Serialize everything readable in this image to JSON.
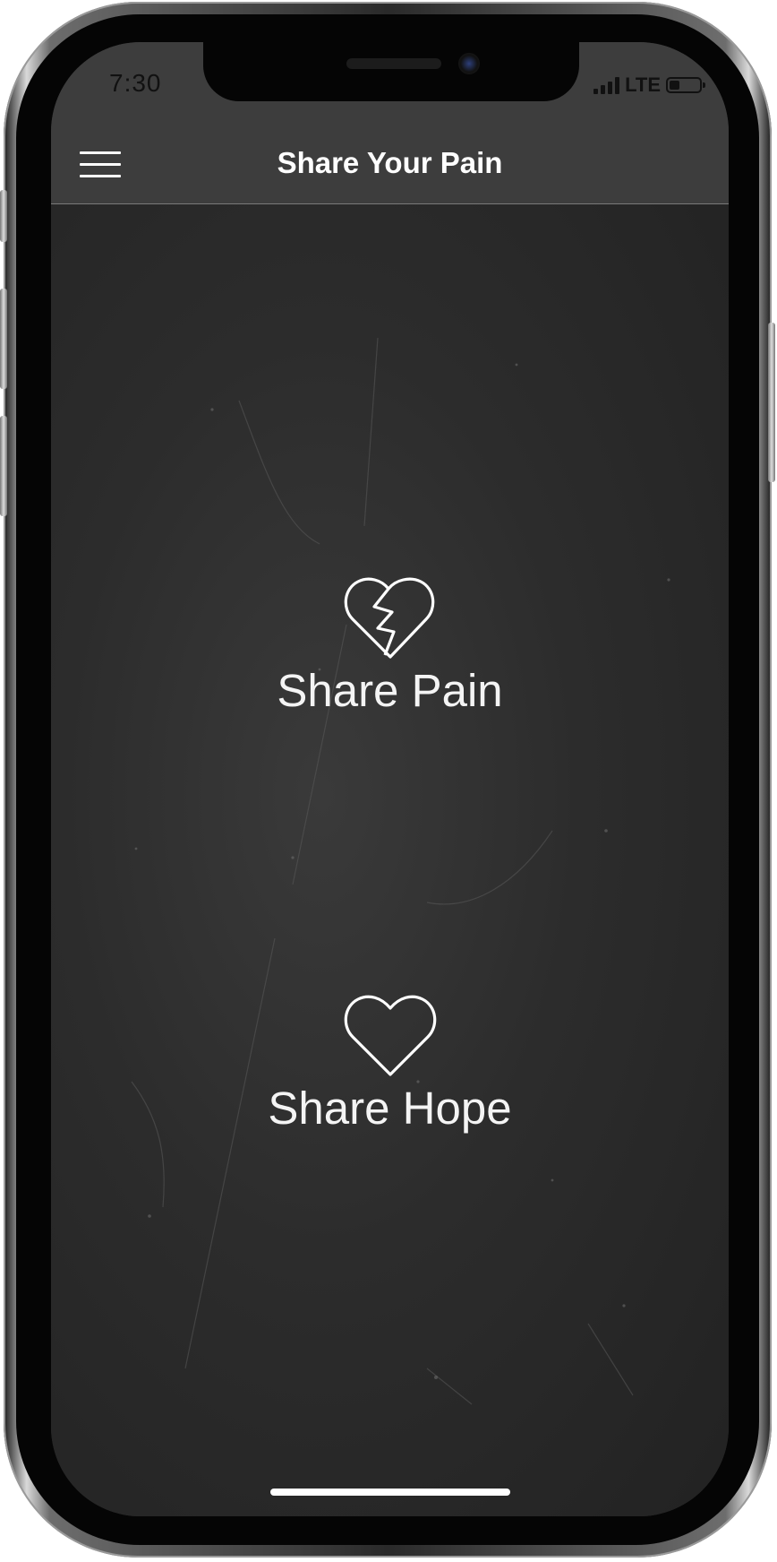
{
  "status_bar": {
    "time": "7:30",
    "network": "LTE",
    "signal_bars": 4,
    "battery_level": 0.35
  },
  "header": {
    "title": "Share Your Pain",
    "menu_icon": "hamburger-menu-icon"
  },
  "actions": [
    {
      "label": "Share Pain",
      "icon": "broken-heart-icon"
    },
    {
      "label": "Share Hope",
      "icon": "heart-icon"
    }
  ],
  "colors": {
    "header_background": "#3d3d3d",
    "screen_background": "#2e2e2e",
    "text": "#ffffff"
  }
}
